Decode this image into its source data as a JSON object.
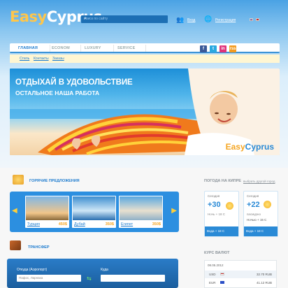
{
  "header": {
    "logo_part1": "Easy",
    "logo_part2": "Cyprus",
    "search_placeholder": "поиск по сайту",
    "login": "Вход",
    "register": "Регистрация"
  },
  "nav": {
    "items": [
      "ГЛАВНАЯ",
      "ECONOM",
      "LUXURY",
      "SERVICE"
    ],
    "active": "ГЛАВНАЯ",
    "social": [
      "f",
      "t",
      "in",
      "rss"
    ]
  },
  "subnav": [
    "Стиль",
    "Контакты",
    "Заказы"
  ],
  "banner": {
    "line1": "ОТДЫХАЙ В УДОВОЛЬСТВИЕ",
    "line2": "ОСТАЛЬНОЕ НАША РАБОТА",
    "brand_part1": "Easy",
    "brand_part2": "Cyprus"
  },
  "hot": {
    "title": "ГОРЯЧИЕ ПРЕДЛОЖЕНИЯ",
    "cards": [
      {
        "name": "Турция",
        "price": "450$"
      },
      {
        "name": "Дубай",
        "price": "350$"
      },
      {
        "name": "Египет",
        "price": "350$"
      }
    ]
  },
  "transfer": {
    "title": "ТРАНСФЕР",
    "from_label": "Откуда (Аэропорт)",
    "to_label": "Куда",
    "from_value": "Пафос, Ларнака"
  },
  "weather": {
    "title": "ПОГОДА НА КИПРЕ",
    "choose_link": "выбрать другой город",
    "cards": [
      {
        "day": "Сегодня",
        "temp": "+30",
        "l1": "Ночь + 18 С",
        "water": "Вода + 18 С"
      },
      {
        "day": "Сегодня",
        "temp": "+22",
        "l1": "пасмурно",
        "l2": "Ночью + 15 С",
        "water": "Вода + 18 С"
      }
    ]
  },
  "currency": {
    "title": "КУРС ВАЛЮТ",
    "date": "08.05.2012",
    "rows": [
      {
        "code": "USD",
        "value": "32.70 RUB"
      },
      {
        "code": "EUR",
        "value": "41.12 RUB"
      }
    ]
  },
  "colors": {
    "accent": "#2a8ad6",
    "brand_yellow": "#ffc64a",
    "price": "#f5a623"
  }
}
